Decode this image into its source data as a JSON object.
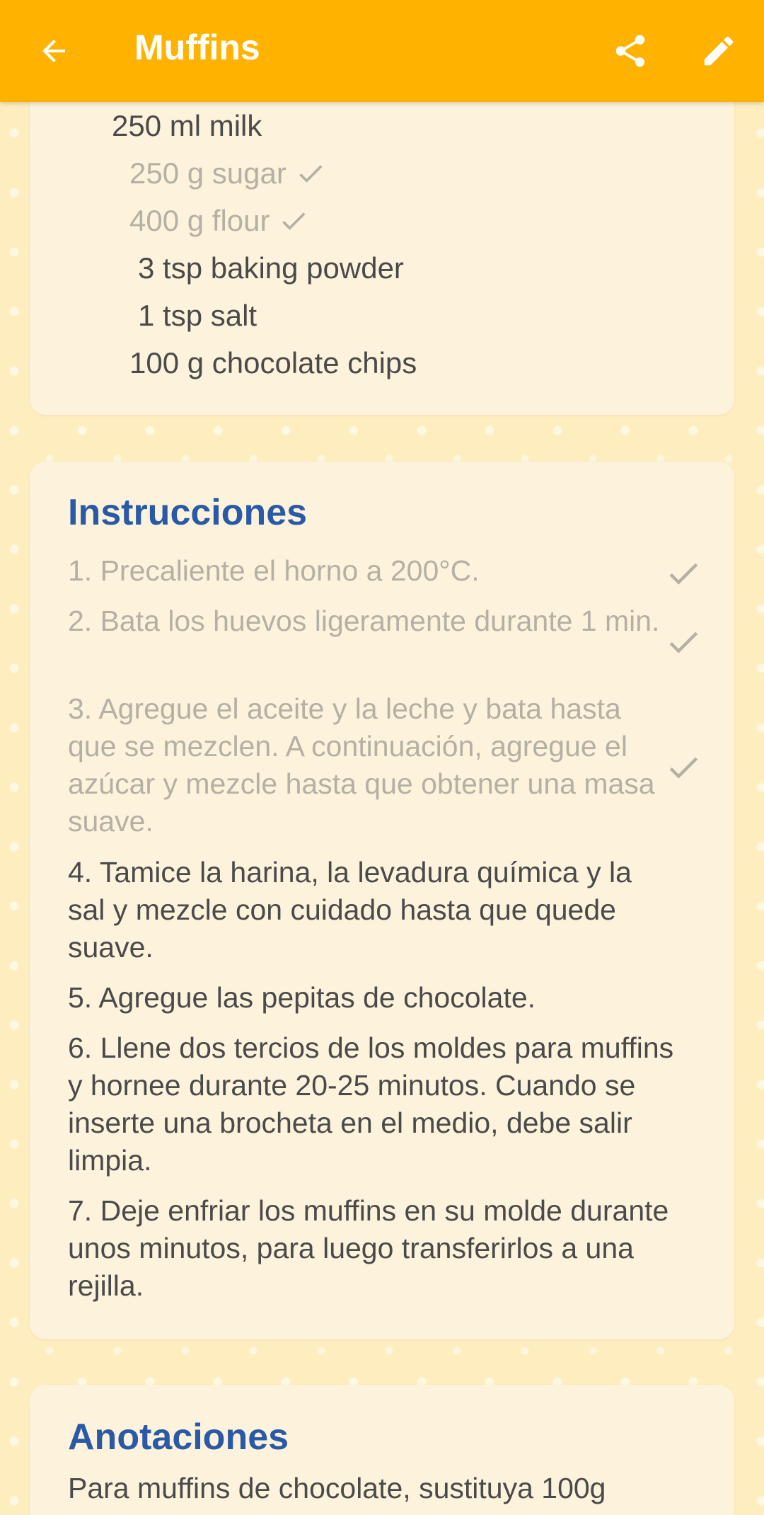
{
  "app_bar": {
    "title": "Muffins",
    "color": "#ffb300"
  },
  "icons": {
    "back": "arrow-back-icon",
    "share": "share-icon",
    "edit": "pencil-icon",
    "check": "check-icon"
  },
  "ingredients": [
    {
      "text": "250 ml milk",
      "checked": false
    },
    {
      "text": "250 g sugar",
      "checked": true
    },
    {
      "text": "400 g flour",
      "checked": true
    },
    {
      "text": "3 tsp baking powder",
      "checked": false
    },
    {
      "text": "1 tsp salt",
      "checked": false
    },
    {
      "text": "100 g chocolate chips",
      "checked": false
    }
  ],
  "instructions": {
    "title": "Instrucciones",
    "steps": [
      {
        "text": "1. Precaliente el horno a 200°C.",
        "checked": true
      },
      {
        "text": "2. Bata los huevos ligeramente durante 1 min.",
        "checked": true
      },
      {
        "text": "3. Agregue el aceite y la leche y bata hasta que se mezclen. A continuación, agregue el azúcar y mezcle hasta que obtener una masa suave.",
        "checked": true
      },
      {
        "text": "4. Tamice la harina, la levadura química y la sal y mezcle con cuidado hasta que quede suave.",
        "checked": false
      },
      {
        "text": "5. Agregue las pepitas de chocolate.",
        "checked": false
      },
      {
        "text": "6. Llene dos tercios de los moldes para muffins y hornee durante 20-25 minutos. Cuando se inserte una brocheta en el medio, debe salir limpia.",
        "checked": false
      },
      {
        "text": "7. Deje enfriar los muffins en su molde durante unos minutos, para luego transferirlos a una rejilla.",
        "checked": false
      }
    ]
  },
  "notes": {
    "title": "Anotaciones",
    "text": "Para muffins de chocolate, sustituya 100g"
  },
  "colors": {
    "heading": "#2a5aa6",
    "text": "#4a4a4a",
    "checked_text": "#b5b0a4",
    "background": "#fdedbf",
    "card": "#fdf3dc"
  }
}
